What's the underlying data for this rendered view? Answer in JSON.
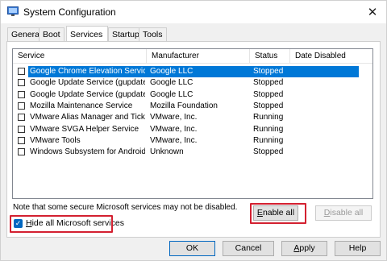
{
  "window": {
    "title": "System Configuration",
    "close_glyph": "✕"
  },
  "tabs": [
    {
      "label": "General"
    },
    {
      "label": "Boot"
    },
    {
      "label": "Services"
    },
    {
      "label": "Startup"
    },
    {
      "label": "Tools"
    }
  ],
  "columns": {
    "service": "Service",
    "manufacturer": "Manufacturer",
    "status": "Status",
    "date_disabled": "Date Disabled"
  },
  "services": [
    {
      "name": "Google Chrome Elevation Servic...",
      "manufacturer": "Google LLC",
      "status": "Stopped",
      "date_disabled": "",
      "checked": false,
      "selected": true
    },
    {
      "name": "Google Update Service (gupdate)",
      "manufacturer": "Google LLC",
      "status": "Stopped",
      "date_disabled": "",
      "checked": false,
      "selected": false
    },
    {
      "name": "Google Update Service (gupdatem)",
      "manufacturer": "Google LLC",
      "status": "Stopped",
      "date_disabled": "",
      "checked": false,
      "selected": false
    },
    {
      "name": "Mozilla Maintenance Service",
      "manufacturer": "Mozilla Foundation",
      "status": "Stopped",
      "date_disabled": "",
      "checked": false,
      "selected": false
    },
    {
      "name": "VMware Alias Manager and Ticke...",
      "manufacturer": "VMware, Inc.",
      "status": "Running",
      "date_disabled": "",
      "checked": false,
      "selected": false
    },
    {
      "name": "VMware SVGA Helper Service",
      "manufacturer": "VMware, Inc.",
      "status": "Running",
      "date_disabled": "",
      "checked": false,
      "selected": false
    },
    {
      "name": "VMware Tools",
      "manufacturer": "VMware, Inc.",
      "status": "Running",
      "date_disabled": "",
      "checked": false,
      "selected": false
    },
    {
      "name": "Windows Subsystem for Android™",
      "manufacturer": "Unknown",
      "status": "Stopped",
      "date_disabled": "",
      "checked": false,
      "selected": false
    }
  ],
  "note": "Note that some secure Microsoft services may not be disabled.",
  "buttons": {
    "enable_all_u": "E",
    "enable_all_rest": "nable all",
    "disable_all_u": "D",
    "disable_all_rest": "isable all",
    "ok": "OK",
    "cancel": "Cancel",
    "apply_u": "A",
    "apply_rest": "pply",
    "help": "Help"
  },
  "hide_ms": {
    "u": "H",
    "rest": "ide all Microsoft services",
    "checked": true
  },
  "colors": {
    "selection": "#0078d7",
    "highlight_box": "#d32030",
    "checkbox_checked": "#0067c0"
  }
}
